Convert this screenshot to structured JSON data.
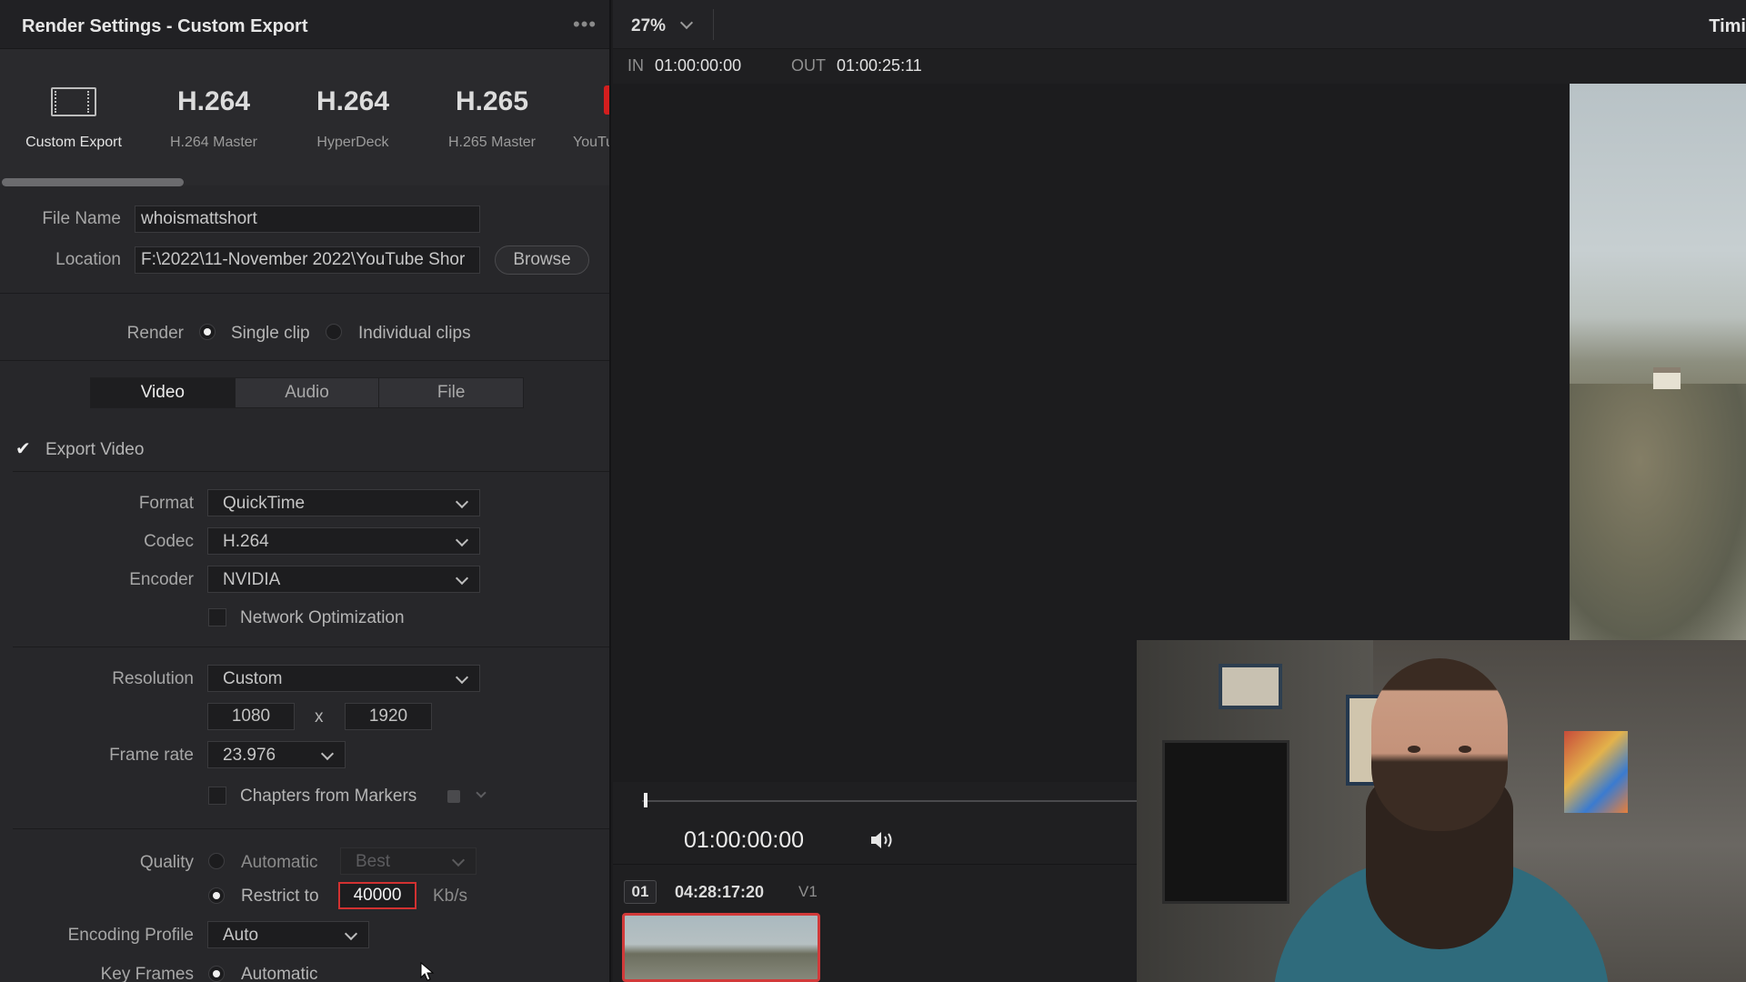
{
  "panel": {
    "title": "Render Settings - Custom Export",
    "more_icon": "more-icon",
    "presets": [
      {
        "big": "",
        "label": "Custom Export",
        "icon": "film-icon"
      },
      {
        "big": "H.264",
        "label": "H.264 Master"
      },
      {
        "big": "H.264",
        "label": "HyperDeck"
      },
      {
        "big": "H.265",
        "label": "H.265 Master"
      },
      {
        "big": "",
        "label": "YouTu"
      }
    ],
    "accent": "#d31e1e"
  },
  "file": {
    "name_label": "File Name",
    "name_value": "whoismattshort",
    "location_label": "Location",
    "location_value": "F:\\2022\\11-November 2022\\YouTube Shor",
    "browse_label": "Browse"
  },
  "render": {
    "label": "Render",
    "single_clip": "Single clip",
    "individual_clips": "Individual clips",
    "selected": "single_clip"
  },
  "tabs": [
    {
      "label": "Video",
      "active": true
    },
    {
      "label": "Audio",
      "active": false
    },
    {
      "label": "File",
      "active": false
    }
  ],
  "video": {
    "export_video_label": "Export Video",
    "export_video_checked": true,
    "format_label": "Format",
    "format_value": "QuickTime",
    "codec_label": "Codec",
    "codec_value": "H.264",
    "encoder_label": "Encoder",
    "encoder_value": "NVIDIA",
    "network_opt_label": "Network Optimization",
    "resolution_label": "Resolution",
    "resolution_value": "Custom",
    "width": "1080",
    "x_sep": "x",
    "height": "1920",
    "frame_rate_label": "Frame rate",
    "frame_rate_value": "23.976",
    "chapters_label": "Chapters from Markers",
    "quality_label": "Quality",
    "automatic_label": "Automatic",
    "quality_best": "Best",
    "restrict_label": "Restrict to",
    "restrict_value": "40000",
    "restrict_unit": "Kb/s",
    "encoding_profile_label": "Encoding Profile",
    "encoding_profile_value": "Auto",
    "key_frames_label": "Key Frames",
    "key_frames_value": "Automatic"
  },
  "viewer": {
    "zoom": "27%",
    "right_title": "Timi",
    "in_label": "IN",
    "in_value": "01:00:00:00",
    "out_label": "OUT",
    "out_value": "01:00:25:11",
    "timecode": "01:00:00:00",
    "speaker_icon": "speaker-icon",
    "clip": {
      "number": "01",
      "timecode": "04:28:17:20",
      "track": "V1"
    },
    "highlight_color": "#d23a3a"
  }
}
